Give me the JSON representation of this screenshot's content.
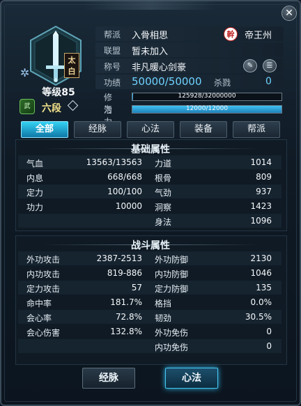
{
  "window": {
    "close_icon": "close-icon"
  },
  "profile": {
    "seal": "太白",
    "level": "等级85",
    "rank": "六段"
  },
  "info": {
    "guild_label": "帮派",
    "guild_value": "入骨相思",
    "guild_emblem": "幹",
    "guild_server": "帝王州",
    "league_label": "联盟",
    "league_value": "暂未加入",
    "title_label": "称号",
    "title_value": "非凡暖心剑豪",
    "merit_label": "功绩",
    "merit_value": "50000/50000",
    "kill_label": "杀戮",
    "kill_value": "0",
    "cultivation_label": "修为",
    "cultivation_value": "125928/32000000",
    "cultivation_fraction": 0.0039,
    "vitality_label": "活力",
    "vitality_value": "12000/12000",
    "vitality_fraction": 1.0
  },
  "tabs": [
    "全部",
    "经脉",
    "心法",
    "装备",
    "帮派"
  ],
  "basic": {
    "title": "基础属性",
    "left": [
      {
        "k": "气血",
        "v": "13563/13563"
      },
      {
        "k": "内息",
        "v": "668/668"
      },
      {
        "k": "定力",
        "v": "100/100"
      },
      {
        "k": "功力",
        "v": "10000"
      }
    ],
    "right": [
      {
        "k": "力道",
        "v": "1014"
      },
      {
        "k": "根骨",
        "v": "809"
      },
      {
        "k": "气劲",
        "v": "937"
      },
      {
        "k": "洞察",
        "v": "1423"
      },
      {
        "k": "身法",
        "v": "1096"
      }
    ]
  },
  "battle": {
    "title": "战斗属性",
    "left": [
      {
        "k": "外功攻击",
        "v": "2387-2513"
      },
      {
        "k": "内功攻击",
        "v": "819-886"
      },
      {
        "k": "定力攻击",
        "v": "57"
      },
      {
        "k": "命中率",
        "v": "181.7%"
      },
      {
        "k": "会心率",
        "v": "72.8%"
      },
      {
        "k": "会心伤害",
        "v": "132.8%"
      }
    ],
    "right": [
      {
        "k": "外功防御",
        "v": "2130"
      },
      {
        "k": "内功防御",
        "v": "1046"
      },
      {
        "k": "定力防御",
        "v": "135"
      },
      {
        "k": "格挡",
        "v": "0.0%"
      },
      {
        "k": "韧劲",
        "v": "30.5%"
      },
      {
        "k": "外功免伤",
        "v": "0"
      },
      {
        "k": "内功免伤",
        "v": "0"
      }
    ]
  },
  "buttons": {
    "meridian": "经脉",
    "mental": "心法"
  }
}
